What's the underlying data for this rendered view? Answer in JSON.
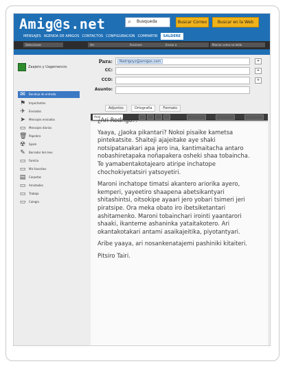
{
  "header": {
    "logo": "Amig@s.net",
    "search_value": "Busqueda",
    "button_1": "Buscar Correo",
    "button_2": "Buscar en la Web",
    "nav": [
      "MENSAJES",
      "AGENDA DE AMIGOS",
      "CONTACTOS",
      "CONFIGURACION",
      "COMPARTIR",
      "SALDERE"
    ],
    "nav_active_index": 5,
    "subbar": [
      "Seleccionar",
      "Ver",
      "Acciones",
      "Enviar a",
      "Marcar como no leído"
    ],
    "icons": {
      "search": "search-icon"
    }
  },
  "sidebar": {
    "top_label": "Zaajero y Uagemencio",
    "items": [
      {
        "label": "Bandeja de entrada",
        "icon": "inbox-icon",
        "glyph": "✉",
        "selected": true
      },
      {
        "label": "Importantes",
        "icon": "flag-icon",
        "glyph": "⚑",
        "selected": false
      },
      {
        "label": "Enviados",
        "icon": "send-icon",
        "glyph": "✈",
        "selected": false
      },
      {
        "label": "Mensajes enviados",
        "icon": "arrow-icon",
        "glyph": "➤",
        "selected": false
      },
      {
        "label": "Mensajes diarios",
        "icon": "folder-icon",
        "glyph": "▭",
        "selected": false
      },
      {
        "label": "Papelera",
        "icon": "trash-icon",
        "glyph": "🗑",
        "selected": false
      },
      {
        "label": "Spam",
        "icon": "spam-icon",
        "glyph": "☢",
        "selected": false
      },
      {
        "label": "Borrador del mes",
        "icon": "draft-icon",
        "glyph": "✎",
        "selected": false
      },
      {
        "label": "Familia",
        "icon": "folder-icon",
        "glyph": "▭",
        "selected": false
      },
      {
        "label": "Mis favoritos",
        "icon": "folder-icon",
        "glyph": "▭",
        "selected": false
      },
      {
        "label": "Carpetas",
        "icon": "folders-icon",
        "glyph": "▤",
        "selected": false
      },
      {
        "label": "Amistades",
        "icon": "folder-icon",
        "glyph": "▭",
        "selected": false
      },
      {
        "label": "Trabajo",
        "icon": "folder-icon",
        "glyph": "▭",
        "selected": false
      },
      {
        "label": "Colegio",
        "icon": "folder-icon",
        "glyph": "▭",
        "selected": false
      }
    ]
  },
  "compose": {
    "para_label": "Para:",
    "to_value": "Rodrigoyz@amigos.com",
    "cc_label": "CC:",
    "bcc_label": "CCO:",
    "subject_label": "Asunto:",
    "side_button": "+"
  },
  "editor": {
    "tabs": [
      "Adjuntos",
      "Ortografía",
      "Formato"
    ],
    "font_select": "Arial",
    "message": [
      "¿Ari Rodrigo?:",
      "Yaaya, ¿Jaoka pikantari? Nokoi pisaike kametsa pintekatsite. Shaiteji ajajeitake aye shaki notsipatanakari apa jero ina, kantimaitacha antaro nobashiretapaka noñapakera osheki shaa tobaincha. Te yamabentakotajearo atiripe inchatope chochokiyetatsiri yatsoyetiri.",
      "Maroni inchatope timatsi akantero ariorika ayero, kemperi, yayeetiro shaapena abetsikantyari shitashintsi, oitsokipe ayaari jero yobari tsimeri jeri piratsipe. Ora meka obato iro ibetsiketantari ashitamenko. Maroni tobainchari irointi yaantarori shaaki, ikanteme ashaninka yataitakotero. Ari okantakotakari antami asaikajeitika, piyotantyari.",
      "Aribe yaaya, ari nosankenatajemi pashiniki kitaiteri.",
      "Pitsiro Tairi."
    ]
  }
}
